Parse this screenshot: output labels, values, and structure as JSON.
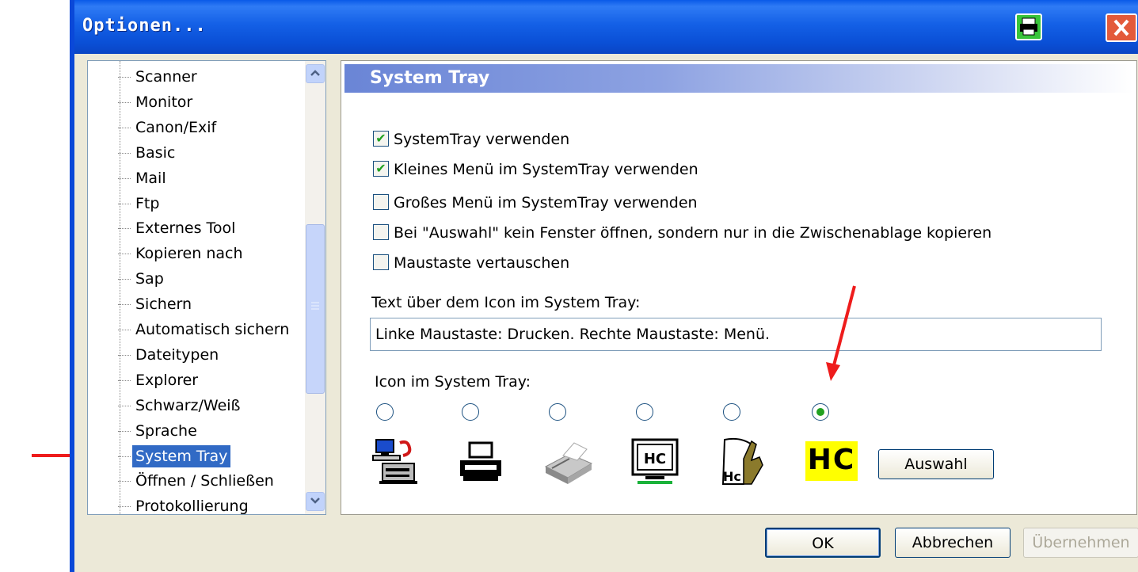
{
  "window": {
    "title": "Optionen..."
  },
  "tree": {
    "items": [
      {
        "label": "Scanner"
      },
      {
        "label": "Monitor"
      },
      {
        "label": "Canon/Exif"
      },
      {
        "label": "Basic"
      },
      {
        "label": "Mail"
      },
      {
        "label": "Ftp"
      },
      {
        "label": "Externes Tool"
      },
      {
        "label": "Kopieren nach"
      },
      {
        "label": "Sap"
      },
      {
        "label": "Sichern"
      },
      {
        "label": "Automatisch sichern"
      },
      {
        "label": "Dateitypen"
      },
      {
        "label": "Explorer"
      },
      {
        "label": "Schwarz/Weiß"
      },
      {
        "label": "Sprache"
      },
      {
        "label": "System Tray",
        "selected": true
      },
      {
        "label": "Öffnen / Schließen"
      },
      {
        "label": "Protokollierung"
      }
    ]
  },
  "panel": {
    "header": "System Tray",
    "checkboxes": [
      {
        "label": "SystemTray verwenden",
        "checked": true
      },
      {
        "label": "Kleines Menü im SystemTray verwenden",
        "checked": true
      },
      {
        "label": "Großes Menü im SystemTray verwenden",
        "checked": false
      },
      {
        "label": "Bei \"Auswahl\" kein Fenster öffnen, sondern nur in die Zwischenablage kopieren",
        "checked": false
      },
      {
        "label": "Maustaste vertauschen",
        "checked": false
      }
    ],
    "tooltip_label": "Text über dem Icon im System Tray:",
    "tooltip_value": "Linke Maustaste: Drucken. Rechte Maustaste: Menü.",
    "icon_label": "Icon im System Tray:",
    "icon_options": [
      {
        "icon": "computer-printer-icon",
        "selected": false
      },
      {
        "icon": "printer-icon",
        "selected": false
      },
      {
        "icon": "grey-printer-icon",
        "selected": false
      },
      {
        "icon": "hc-monitor-icon",
        "selected": false
      },
      {
        "icon": "hc-hand-icon",
        "selected": false
      },
      {
        "icon": "hc-yellow-icon",
        "selected": true,
        "text": "HC"
      }
    ],
    "hc_monitor_text": "HC",
    "hc_hand_text": "Hc",
    "auswahl_button": "Auswahl"
  },
  "footer": {
    "ok": "OK",
    "cancel": "Abbrechen",
    "apply": "Übernehmen"
  },
  "colors": {
    "titlebar": "#0a5ae8",
    "selection": "#316ac5",
    "annotation_arrow": "#ee1c1c",
    "check": "#21a121",
    "hc_yellow": "#ffff00"
  }
}
